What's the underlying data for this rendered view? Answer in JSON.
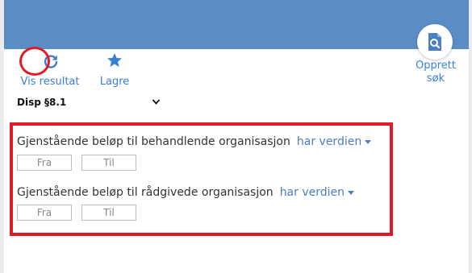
{
  "toolbar": {
    "refresh_label": "Vis resultat",
    "save_label": "Lagre",
    "create_search_label": "Opprett søk"
  },
  "select": {
    "value": "Disp §8.1"
  },
  "criteria": [
    {
      "label": "Gjenstående beløp til behandlende organisasjon",
      "operator": "har verdien",
      "from_placeholder": "Fra",
      "to_placeholder": "Til"
    },
    {
      "label": "Gjenstående beløp til rådgivede organisasjon",
      "operator": "har verdien",
      "from_placeholder": "Fra",
      "to_placeholder": "Til"
    }
  ],
  "colors": {
    "header": "#5a8cc6",
    "accent": "#3a80d2",
    "annotation": "#e01c24"
  },
  "icons": [
    "refresh-icon",
    "star-icon",
    "document-search-icon",
    "chevron-down-icon"
  ]
}
